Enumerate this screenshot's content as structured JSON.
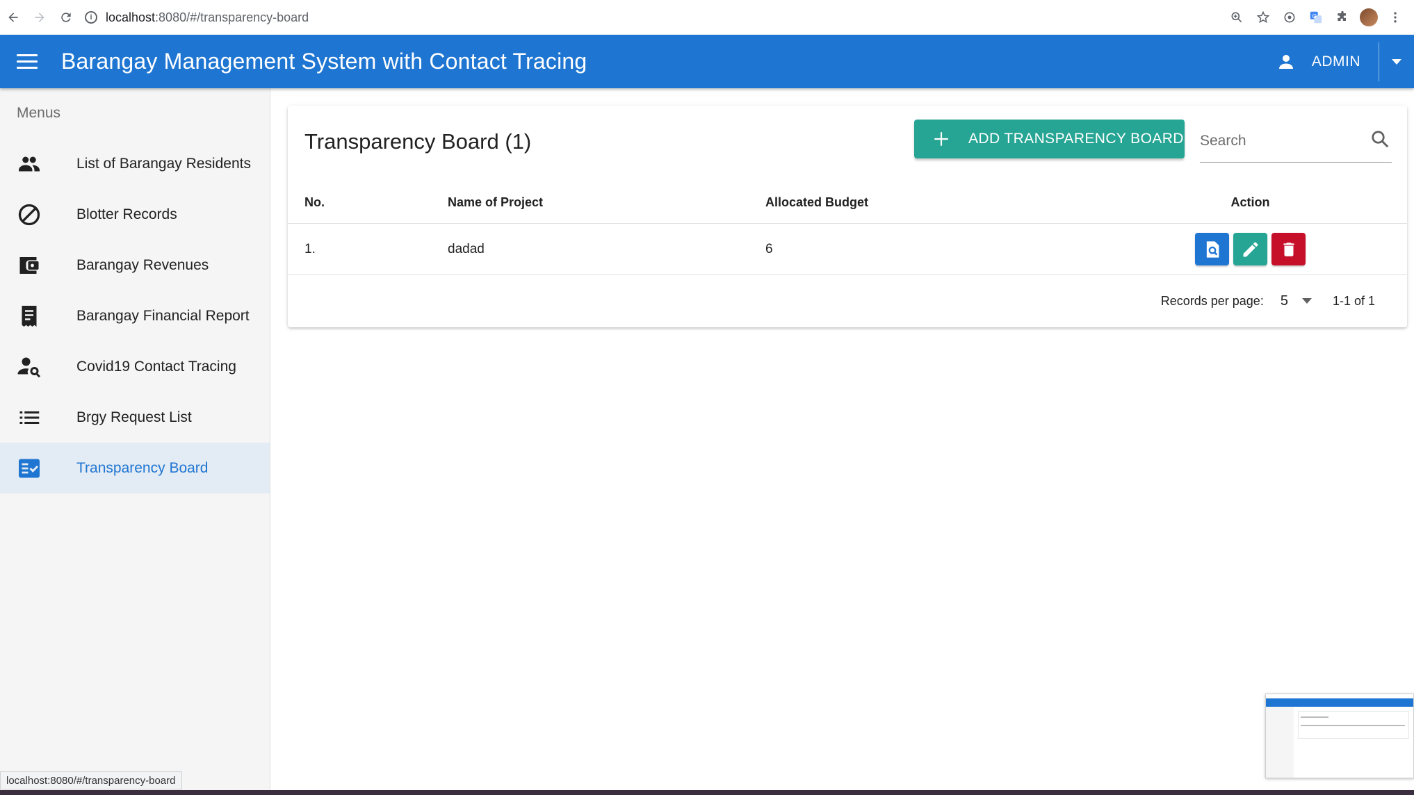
{
  "browser": {
    "url_host": "localhost",
    "url_path": ":8080/#/transparency-board",
    "status_url": "localhost:8080/#/transparency-board"
  },
  "app_bar": {
    "title": "Barangay Management System with Contact Tracing",
    "user_label": "ADMIN",
    "color": "#1f76d2"
  },
  "sidebar": {
    "subheader": "Menus",
    "items": [
      {
        "label": "List of Barangay Residents",
        "icon": "people-icon"
      },
      {
        "label": "Blotter Records",
        "icon": "block-icon"
      },
      {
        "label": "Barangay Revenues",
        "icon": "wallet-icon"
      },
      {
        "label": "Barangay Financial Report",
        "icon": "receipt-icon"
      },
      {
        "label": "Covid19 Contact Tracing",
        "icon": "person-search-icon"
      },
      {
        "label": "Brgy Request List",
        "icon": "list-icon"
      },
      {
        "label": "Transparency Board",
        "icon": "fact-check-icon",
        "active": true
      }
    ]
  },
  "card": {
    "title": "Transparency Board (1)",
    "add_button_label": "ADD TRANSPARENCY BOARD",
    "search_placeholder": "Search",
    "table": {
      "headers": [
        "No.",
        "Name of Project",
        "Allocated Budget",
        "Action"
      ],
      "rows": [
        {
          "no": "1.",
          "name": "dadad",
          "budget": "6"
        }
      ]
    },
    "pager": {
      "rows_per_page_label": "Records per page:",
      "rows_per_page": "5",
      "range": "1-1 of 1"
    }
  },
  "colors": {
    "primary": "#1f76d2",
    "teal": "#27a594",
    "danger": "#c6102a"
  }
}
